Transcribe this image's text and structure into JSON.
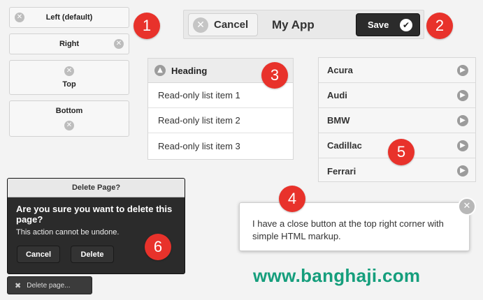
{
  "icon_buttons": {
    "left": {
      "label": "Left (default)",
      "icon": "close-icon"
    },
    "right": {
      "label": "Right",
      "icon": "close-icon"
    },
    "top": {
      "label": "Top",
      "icon": "close-icon"
    },
    "bottom": {
      "label": "Bottom",
      "icon": "close-icon"
    }
  },
  "header": {
    "cancel_label": "Cancel",
    "title": "My App",
    "save_label": "Save"
  },
  "collapsible": {
    "heading": "Heading",
    "items": [
      "Read-only list item 1",
      "Read-only list item 2",
      "Read-only list item 3"
    ]
  },
  "cars": [
    "Acura",
    "Audi",
    "BMW",
    "Cadillac",
    "Ferrari"
  ],
  "popup": {
    "message": "I have a close button at the top right corner with simple HTML markup."
  },
  "dialog": {
    "title": "Delete Page?",
    "question": "Are you sure you want to delete this page?",
    "subtext": "This action cannot be undone.",
    "cancel_label": "Cancel",
    "delete_label": "Delete"
  },
  "delete_page_button": "Delete page...",
  "badges": [
    "1",
    "2",
    "3",
    "4",
    "5",
    "6"
  ],
  "watermark": "www.banghaji.com",
  "colors": {
    "badge": "#e8322b",
    "watermark": "#159e7c",
    "dark": "#2b2b2b"
  }
}
